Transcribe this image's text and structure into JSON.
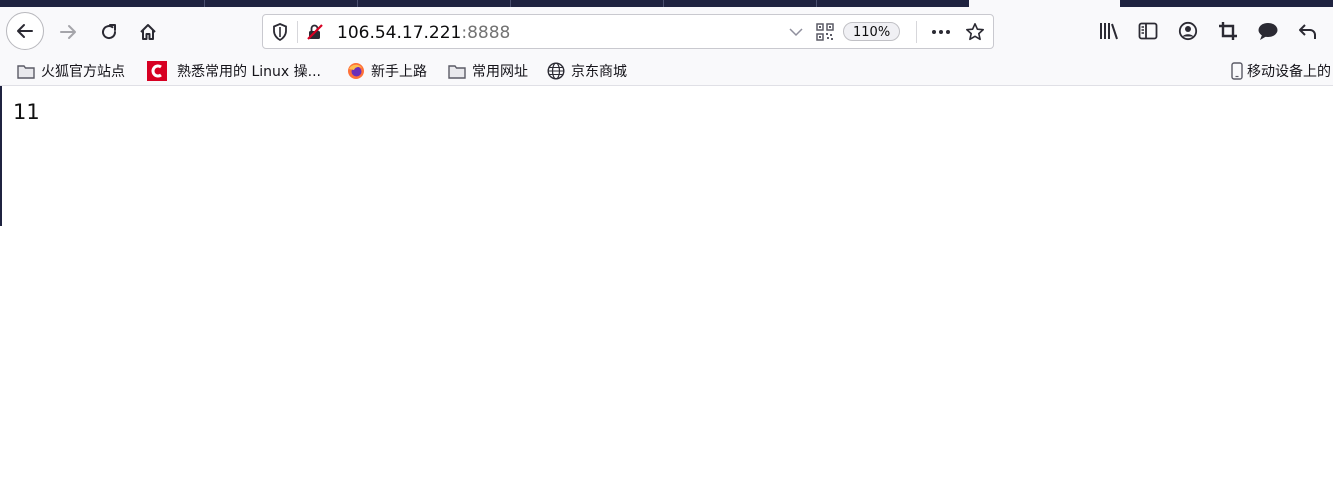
{
  "toolbar": {
    "url_host": "106.54.17.221",
    "url_port": ":8888",
    "zoom": "110%"
  },
  "bookmarks": [
    {
      "label": "火狐官方站点",
      "icon": "folder-icon"
    },
    {
      "label": "熟悉常用的 Linux 操...",
      "icon": "red-c-icon"
    },
    {
      "label": "新手上路",
      "icon": "firefox-icon"
    },
    {
      "label": "常用网址",
      "icon": "folder-icon"
    },
    {
      "label": "京东商城",
      "icon": "globe-icon"
    }
  ],
  "mobile_bookmarks": {
    "label": "移动设备上的",
    "icon": "mobile-icon"
  },
  "page": {
    "body_text": "11"
  },
  "colors": {
    "tabstrip": "#1f2340",
    "toolbar": "#f9f9fb",
    "accent_red": "#d70022"
  }
}
